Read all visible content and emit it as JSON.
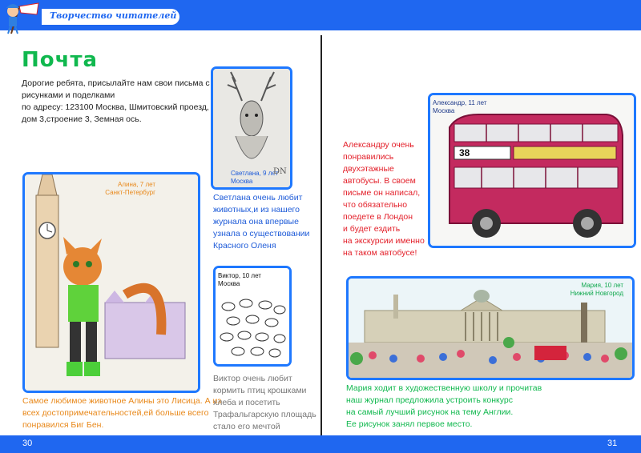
{
  "header": {
    "title": "Творчество читателей"
  },
  "section_title": "Почта",
  "intro_lines": [
    "Дорогие ребята, присылайте нам свои письма с",
    "рисунками и поделками",
    "по адресу: 123100 Москва, Шмитовский проезд,",
    "дом 3,строение 3, Земная ось."
  ],
  "alina": {
    "caption_name": "Алина, 7 лет",
    "caption_city": "Санкт-Петербург",
    "text_lines": [
      "Самое любимое животное Алины это Лисица. А из",
      "всех достопримечательностей,ей больше всего",
      "понравился Биг Бен."
    ]
  },
  "svetlana": {
    "caption_name": "Светлана, 9 лет",
    "caption_city": "Москва",
    "signature": "DN",
    "text_lines": [
      "Светлана очень любит",
      "животных,и из нашего",
      "журнала она впервые",
      "узнала о существовании",
      "Красного Оленя"
    ]
  },
  "viktor": {
    "caption_name": "Виктор, 10 лет",
    "caption_city": "Москва",
    "text_lines": [
      "Виктор очень любит",
      "кормить птиц крошками",
      "хлеба и посетить",
      "Трафальгарскую площадь",
      "стало его мечтой"
    ]
  },
  "alexander": {
    "caption_name": "Александр, 11 лет",
    "caption_city": "Москва",
    "text_lines": [
      "Александру очень",
      "понравились",
      "двухэтажные",
      "автобусы. В своем",
      "письме он написал,",
      "что обязательно",
      "поедете в Лондон",
      "и будет ездить",
      "на экскурсии  именно",
      "на таком автобусе!"
    ],
    "bus_number": "38"
  },
  "maria": {
    "caption_name": "Мария, 10 лет",
    "caption_city": "Нижний Новгород",
    "text_lines": [
      "Мария ходит в художественную школу и прочитав",
      "наш журнал предложила устроить конкурс",
      "на самый лучший рисунок на тему Англии.",
      "Ее рисунок занял первое место."
    ]
  },
  "footer": {
    "left_page": "30",
    "right_page": "31"
  },
  "colors": {
    "blue": "#1f67f0",
    "green": "#10b84e",
    "orange": "#e8881a",
    "red": "#e3202a",
    "frame": "#1e78ff",
    "body_text": "#222222"
  }
}
